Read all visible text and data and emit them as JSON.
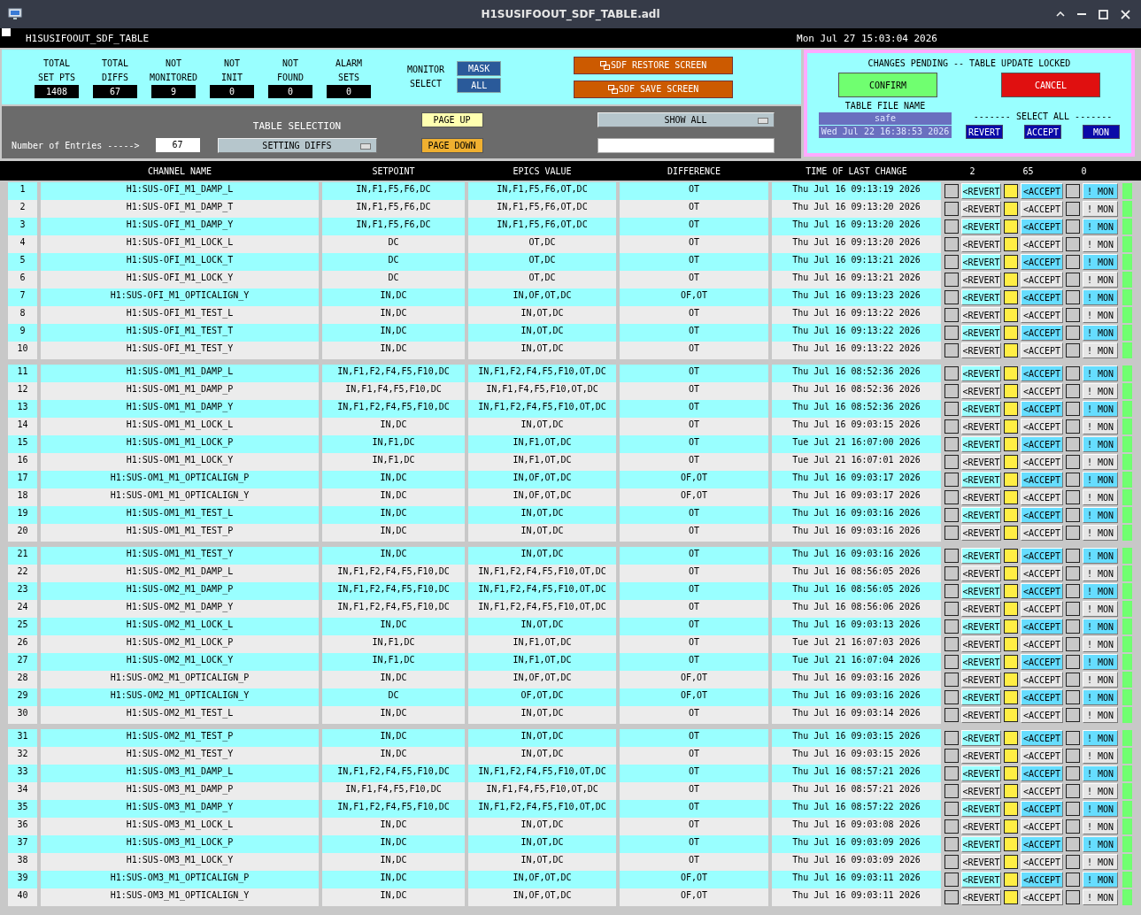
{
  "window": {
    "title": "H1SUSIFOOUT_SDF_TABLE.adl"
  },
  "header": {
    "screen_name": "H1SUSIFOOUT_SDF_TABLE",
    "datetime": "Mon Jul 27 15:03:04 2026"
  },
  "stats": [
    {
      "label": [
        "TOTAL",
        "SET PTS"
      ],
      "value": "1408"
    },
    {
      "label": [
        "TOTAL",
        "DIFFS"
      ],
      "value": "67"
    },
    {
      "label": [
        "NOT",
        "MONITORED"
      ],
      "value": "9"
    },
    {
      "label": [
        "NOT",
        "INIT"
      ],
      "value": "0"
    },
    {
      "label": [
        "NOT",
        "FOUND"
      ],
      "value": "0"
    },
    {
      "label": [
        "ALARM",
        "SETS"
      ],
      "value": "0"
    }
  ],
  "monitor_select": {
    "label": [
      "MONITOR",
      "SELECT"
    ],
    "buttons": [
      "MASK",
      "ALL"
    ]
  },
  "screen_buttons": [
    "SDF RESTORE SCREEN",
    "SDF SAVE SCREEN"
  ],
  "pending": {
    "message": "CHANGES PENDING -- TABLE UPDATE LOCKED",
    "confirm": "CONFIRM",
    "cancel": "CANCEL",
    "file_label": "TABLE FILE NAME",
    "file_name": "safe",
    "file_time": "Wed Jul 22 16:38:53 2026",
    "select_all_label": "------- SELECT ALL -------",
    "select_all_buttons": [
      "REVERT",
      "ACCEPT",
      "MON"
    ]
  },
  "table_selection": {
    "label": "TABLE SELECTION",
    "entries_label": "Number of Entries ----->",
    "entries": "67",
    "selection": "SETTING DIFFS",
    "page_buttons": [
      "PAGE UP",
      "PAGE DOWN"
    ],
    "filter": "SHOW ALL"
  },
  "table": {
    "columns": [
      "CHANNEL NAME",
      "SETPOINT",
      "EPICS VALUE",
      "DIFFERENCE",
      "TIME OF LAST CHANGE",
      "2",
      "65",
      "0"
    ],
    "rows": [
      {
        "index": "1",
        "channel": "H1:SUS-OFI_M1_DAMP_L",
        "setpoint": "IN,F1,F5,F6,DC",
        "epics_value": "IN,F1,F5,F6,OT,DC",
        "difference": "OT",
        "time": "Thu Jul 16 09:13:19 2026",
        "revert_checked": false,
        "revert": "<REVERT",
        "accept_checked": true,
        "accept": "<ACCEPT",
        "mon_checked": false,
        "mon": "! MON"
      },
      {
        "index": "2",
        "channel": "H1:SUS-OFI_M1_DAMP_T",
        "setpoint": "IN,F1,F5,F6,DC",
        "epics_value": "IN,F1,F5,F6,OT,DC",
        "difference": "OT",
        "time": "Thu Jul 16 09:13:20 2026",
        "revert_checked": false,
        "revert": "<REVERT",
        "accept_checked": true,
        "accept": "<ACCEPT",
        "mon_checked": false,
        "mon": "! MON"
      },
      {
        "index": "3",
        "channel": "H1:SUS-OFI_M1_DAMP_Y",
        "setpoint": "IN,F1,F5,F6,DC",
        "epics_value": "IN,F1,F5,F6,OT,DC",
        "difference": "OT",
        "time": "Thu Jul 16 09:13:20 2026",
        "revert_checked": false,
        "revert": "<REVERT",
        "accept_checked": true,
        "accept": "<ACCEPT",
        "mon_checked": false,
        "mon": "! MON"
      },
      {
        "index": "4",
        "channel": "H1:SUS-OFI_M1_LOCK_L",
        "setpoint": "DC",
        "epics_value": "OT,DC",
        "difference": "OT",
        "time": "Thu Jul 16 09:13:20 2026",
        "revert_checked": false,
        "revert": "<REVERT",
        "accept_checked": true,
        "accept": "<ACCEPT",
        "mon_checked": false,
        "mon": "! MON"
      },
      {
        "index": "5",
        "channel": "H1:SUS-OFI_M1_LOCK_T",
        "setpoint": "DC",
        "epics_value": "OT,DC",
        "difference": "OT",
        "time": "Thu Jul 16 09:13:21 2026",
        "revert_checked": false,
        "revert": "<REVERT",
        "accept_checked": true,
        "accept": "<ACCEPT",
        "mon_checked": false,
        "mon": "! MON"
      },
      {
        "index": "6",
        "channel": "H1:SUS-OFI_M1_LOCK_Y",
        "setpoint": "DC",
        "epics_value": "OT,DC",
        "difference": "OT",
        "time": "Thu Jul 16 09:13:21 2026",
        "revert_checked": false,
        "revert": "<REVERT",
        "accept_checked": true,
        "accept": "<ACCEPT",
        "mon_checked": false,
        "mon": "! MON"
      },
      {
        "index": "7",
        "channel": "H1:SUS-OFI_M1_OPTICALIGN_Y",
        "setpoint": "IN,DC",
        "epics_value": "IN,OF,OT,DC",
        "difference": "OF,OT",
        "time": "Thu Jul 16 09:13:23 2026",
        "revert_checked": false,
        "revert": "<REVERT",
        "accept_checked": true,
        "accept": "<ACCEPT",
        "mon_checked": false,
        "mon": "! MON"
      },
      {
        "index": "8",
        "channel": "H1:SUS-OFI_M1_TEST_L",
        "setpoint": "IN,DC",
        "epics_value": "IN,OT,DC",
        "difference": "OT",
        "time": "Thu Jul 16 09:13:22 2026",
        "revert_checked": false,
        "revert": "<REVERT",
        "accept_checked": true,
        "accept": "<ACCEPT",
        "mon_checked": false,
        "mon": "! MON"
      },
      {
        "index": "9",
        "channel": "H1:SUS-OFI_M1_TEST_T",
        "setpoint": "IN,DC",
        "epics_value": "IN,OT,DC",
        "difference": "OT",
        "time": "Thu Jul 16 09:13:22 2026",
        "revert_checked": false,
        "revert": "<REVERT",
        "accept_checked": true,
        "accept": "<ACCEPT",
        "mon_checked": false,
        "mon": "! MON"
      },
      {
        "index": "10",
        "channel": "H1:SUS-OFI_M1_TEST_Y",
        "setpoint": "IN,DC",
        "epics_value": "IN,OT,DC",
        "difference": "OT",
        "time": "Thu Jul 16 09:13:22 2026",
        "revert_checked": false,
        "revert": "<REVERT",
        "accept_checked": true,
        "accept": "<ACCEPT",
        "mon_checked": false,
        "mon": "! MON"
      },
      {
        "index": "11",
        "channel": "H1:SUS-OM1_M1_DAMP_L",
        "setpoint": "IN,F1,F2,F4,F5,F10,DC",
        "epics_value": "IN,F1,F2,F4,F5,F10,OT,DC",
        "difference": "OT",
        "time": "Thu Jul 16 08:52:36 2026",
        "revert_checked": false,
        "revert": "<REVERT",
        "accept_checked": true,
        "accept": "<ACCEPT",
        "mon_checked": false,
        "mon": "! MON"
      },
      {
        "index": "12",
        "channel": "H1:SUS-OM1_M1_DAMP_P",
        "setpoint": "IN,F1,F4,F5,F10,DC",
        "epics_value": "IN,F1,F4,F5,F10,OT,DC",
        "difference": "OT",
        "time": "Thu Jul 16 08:52:36 2026",
        "revert_checked": false,
        "revert": "<REVERT",
        "accept_checked": true,
        "accept": "<ACCEPT",
        "mon_checked": false,
        "mon": "! MON"
      },
      {
        "index": "13",
        "channel": "H1:SUS-OM1_M1_DAMP_Y",
        "setpoint": "IN,F1,F2,F4,F5,F10,DC",
        "epics_value": "IN,F1,F2,F4,F5,F10,OT,DC",
        "difference": "OT",
        "time": "Thu Jul 16 08:52:36 2026",
        "revert_checked": false,
        "revert": "<REVERT",
        "accept_checked": true,
        "accept": "<ACCEPT",
        "mon_checked": false,
        "mon": "! MON"
      },
      {
        "index": "14",
        "channel": "H1:SUS-OM1_M1_LOCK_L",
        "setpoint": "IN,DC",
        "epics_value": "IN,OT,DC",
        "difference": "OT",
        "time": "Thu Jul 16 09:03:15 2026",
        "revert_checked": false,
        "revert": "<REVERT",
        "accept_checked": true,
        "accept": "<ACCEPT",
        "mon_checked": false,
        "mon": "! MON"
      },
      {
        "index": "15",
        "channel": "H1:SUS-OM1_M1_LOCK_P",
        "setpoint": "IN,F1,DC",
        "epics_value": "IN,F1,OT,DC",
        "difference": "OT",
        "time": "Tue Jul 21 16:07:00 2026",
        "revert_checked": false,
        "revert": "<REVERT",
        "accept_checked": true,
        "accept": "<ACCEPT",
        "mon_checked": false,
        "mon": "! MON"
      },
      {
        "index": "16",
        "channel": "H1:SUS-OM1_M1_LOCK_Y",
        "setpoint": "IN,F1,DC",
        "epics_value": "IN,F1,OT,DC",
        "difference": "OT",
        "time": "Tue Jul 21 16:07:01 2026",
        "revert_checked": false,
        "revert": "<REVERT",
        "accept_checked": true,
        "accept": "<ACCEPT",
        "mon_checked": false,
        "mon": "! MON"
      },
      {
        "index": "17",
        "channel": "H1:SUS-OM1_M1_OPTICALIGN_P",
        "setpoint": "IN,DC",
        "epics_value": "IN,OF,OT,DC",
        "difference": "OF,OT",
        "time": "Thu Jul 16 09:03:17 2026",
        "revert_checked": false,
        "revert": "<REVERT",
        "accept_checked": true,
        "accept": "<ACCEPT",
        "mon_checked": false,
        "mon": "! MON"
      },
      {
        "index": "18",
        "channel": "H1:SUS-OM1_M1_OPTICALIGN_Y",
        "setpoint": "IN,DC",
        "epics_value": "IN,OF,OT,DC",
        "difference": "OF,OT",
        "time": "Thu Jul 16 09:03:17 2026",
        "revert_checked": false,
        "revert": "<REVERT",
        "accept_checked": true,
        "accept": "<ACCEPT",
        "mon_checked": false,
        "mon": "! MON"
      },
      {
        "index": "19",
        "channel": "H1:SUS-OM1_M1_TEST_L",
        "setpoint": "IN,DC",
        "epics_value": "IN,OT,DC",
        "difference": "OT",
        "time": "Thu Jul 16 09:03:16 2026",
        "revert_checked": false,
        "revert": "<REVERT",
        "accept_checked": true,
        "accept": "<ACCEPT",
        "mon_checked": false,
        "mon": "! MON"
      },
      {
        "index": "20",
        "channel": "H1:SUS-OM1_M1_TEST_P",
        "setpoint": "IN,DC",
        "epics_value": "IN,OT,DC",
        "difference": "OT",
        "time": "Thu Jul 16 09:03:16 2026",
        "revert_checked": false,
        "revert": "<REVERT",
        "accept_checked": true,
        "accept": "<ACCEPT",
        "mon_checked": false,
        "mon": "! MON"
      },
      {
        "index": "21",
        "channel": "H1:SUS-OM1_M1_TEST_Y",
        "setpoint": "IN,DC",
        "epics_value": "IN,OT,DC",
        "difference": "OT",
        "time": "Thu Jul 16 09:03:16 2026",
        "revert_checked": false,
        "revert": "<REVERT",
        "accept_checked": true,
        "accept": "<ACCEPT",
        "mon_checked": false,
        "mon": "! MON"
      },
      {
        "index": "22",
        "channel": "H1:SUS-OM2_M1_DAMP_L",
        "setpoint": "IN,F1,F2,F4,F5,F10,DC",
        "epics_value": "IN,F1,F2,F4,F5,F10,OT,DC",
        "difference": "OT",
        "time": "Thu Jul 16 08:56:05 2026",
        "revert_checked": false,
        "revert": "<REVERT",
        "accept_checked": true,
        "accept": "<ACCEPT",
        "mon_checked": false,
        "mon": "! MON"
      },
      {
        "index": "23",
        "channel": "H1:SUS-OM2_M1_DAMP_P",
        "setpoint": "IN,F1,F2,F4,F5,F10,DC",
        "epics_value": "IN,F1,F2,F4,F5,F10,OT,DC",
        "difference": "OT",
        "time": "Thu Jul 16 08:56:05 2026",
        "revert_checked": false,
        "revert": "<REVERT",
        "accept_checked": true,
        "accept": "<ACCEPT",
        "mon_checked": false,
        "mon": "! MON"
      },
      {
        "index": "24",
        "channel": "H1:SUS-OM2_M1_DAMP_Y",
        "setpoint": "IN,F1,F2,F4,F5,F10,DC",
        "epics_value": "IN,F1,F2,F4,F5,F10,OT,DC",
        "difference": "OT",
        "time": "Thu Jul 16 08:56:06 2026",
        "revert_checked": false,
        "revert": "<REVERT",
        "accept_checked": true,
        "accept": "<ACCEPT",
        "mon_checked": false,
        "mon": "! MON"
      },
      {
        "index": "25",
        "channel": "H1:SUS-OM2_M1_LOCK_L",
        "setpoint": "IN,DC",
        "epics_value": "IN,OT,DC",
        "difference": "OT",
        "time": "Thu Jul 16 09:03:13 2026",
        "revert_checked": false,
        "revert": "<REVERT",
        "accept_checked": true,
        "accept": "<ACCEPT",
        "mon_checked": false,
        "mon": "! MON"
      },
      {
        "index": "26",
        "channel": "H1:SUS-OM2_M1_LOCK_P",
        "setpoint": "IN,F1,DC",
        "epics_value": "IN,F1,OT,DC",
        "difference": "OT",
        "time": "Tue Jul 21 16:07:03 2026",
        "revert_checked": false,
        "revert": "<REVERT",
        "accept_checked": true,
        "accept": "<ACCEPT",
        "mon_checked": false,
        "mon": "! MON"
      },
      {
        "index": "27",
        "channel": "H1:SUS-OM2_M1_LOCK_Y",
        "setpoint": "IN,F1,DC",
        "epics_value": "IN,F1,OT,DC",
        "difference": "OT",
        "time": "Tue Jul 21 16:07:04 2026",
        "revert_checked": false,
        "revert": "<REVERT",
        "accept_checked": true,
        "accept": "<ACCEPT",
        "mon_checked": false,
        "mon": "! MON"
      },
      {
        "index": "28",
        "channel": "H1:SUS-OM2_M1_OPTICALIGN_P",
        "setpoint": "IN,DC",
        "epics_value": "IN,OF,OT,DC",
        "difference": "OF,OT",
        "time": "Thu Jul 16 09:03:16 2026",
        "revert_checked": false,
        "revert": "<REVERT",
        "accept_checked": true,
        "accept": "<ACCEPT",
        "mon_checked": false,
        "mon": "! MON"
      },
      {
        "index": "29",
        "channel": "H1:SUS-OM2_M1_OPTICALIGN_Y",
        "setpoint": "DC",
        "epics_value": "OF,OT,DC",
        "difference": "OF,OT",
        "time": "Thu Jul 16 09:03:16 2026",
        "revert_checked": false,
        "revert": "<REVERT",
        "accept_checked": true,
        "accept": "<ACCEPT",
        "mon_checked": false,
        "mon": "! MON"
      },
      {
        "index": "30",
        "channel": "H1:SUS-OM2_M1_TEST_L",
        "setpoint": "IN,DC",
        "epics_value": "IN,OT,DC",
        "difference": "OT",
        "time": "Thu Jul 16 09:03:14 2026",
        "revert_checked": false,
        "revert": "<REVERT",
        "accept_checked": true,
        "accept": "<ACCEPT",
        "mon_checked": false,
        "mon": "! MON"
      },
      {
        "index": "31",
        "channel": "H1:SUS-OM2_M1_TEST_P",
        "setpoint": "IN,DC",
        "epics_value": "IN,OT,DC",
        "difference": "OT",
        "time": "Thu Jul 16 09:03:15 2026",
        "revert_checked": false,
        "revert": "<REVERT",
        "accept_checked": true,
        "accept": "<ACCEPT",
        "mon_checked": false,
        "mon": "! MON"
      },
      {
        "index": "32",
        "channel": "H1:SUS-OM2_M1_TEST_Y",
        "setpoint": "IN,DC",
        "epics_value": "IN,OT,DC",
        "difference": "OT",
        "time": "Thu Jul 16 09:03:15 2026",
        "revert_checked": false,
        "revert": "<REVERT",
        "accept_checked": true,
        "accept": "<ACCEPT",
        "mon_checked": false,
        "mon": "! MON"
      },
      {
        "index": "33",
        "channel": "H1:SUS-OM3_M1_DAMP_L",
        "setpoint": "IN,F1,F2,F4,F5,F10,DC",
        "epics_value": "IN,F1,F2,F4,F5,F10,OT,DC",
        "difference": "OT",
        "time": "Thu Jul 16 08:57:21 2026",
        "revert_checked": false,
        "revert": "<REVERT",
        "accept_checked": true,
        "accept": "<ACCEPT",
        "mon_checked": false,
        "mon": "! MON"
      },
      {
        "index": "34",
        "channel": "H1:SUS-OM3_M1_DAMP_P",
        "setpoint": "IN,F1,F4,F5,F10,DC",
        "epics_value": "IN,F1,F4,F5,F10,OT,DC",
        "difference": "OT",
        "time": "Thu Jul 16 08:57:21 2026",
        "revert_checked": false,
        "revert": "<REVERT",
        "accept_checked": true,
        "accept": "<ACCEPT",
        "mon_checked": false,
        "mon": "! MON"
      },
      {
        "index": "35",
        "channel": "H1:SUS-OM3_M1_DAMP_Y",
        "setpoint": "IN,F1,F2,F4,F5,F10,DC",
        "epics_value": "IN,F1,F2,F4,F5,F10,OT,DC",
        "difference": "OT",
        "time": "Thu Jul 16 08:57:22 2026",
        "revert_checked": false,
        "revert": "<REVERT",
        "accept_checked": true,
        "accept": "<ACCEPT",
        "mon_checked": false,
        "mon": "! MON"
      },
      {
        "index": "36",
        "channel": "H1:SUS-OM3_M1_LOCK_L",
        "setpoint": "IN,DC",
        "epics_value": "IN,OT,DC",
        "difference": "OT",
        "time": "Thu Jul 16 09:03:08 2026",
        "revert_checked": false,
        "revert": "<REVERT",
        "accept_checked": true,
        "accept": "<ACCEPT",
        "mon_checked": false,
        "mon": "! MON"
      },
      {
        "index": "37",
        "channel": "H1:SUS-OM3_M1_LOCK_P",
        "setpoint": "IN,DC",
        "epics_value": "IN,OT,DC",
        "difference": "OT",
        "time": "Thu Jul 16 09:03:09 2026",
        "revert_checked": false,
        "revert": "<REVERT",
        "accept_checked": true,
        "accept": "<ACCEPT",
        "mon_checked": false,
        "mon": "! MON"
      },
      {
        "index": "38",
        "channel": "H1:SUS-OM3_M1_LOCK_Y",
        "setpoint": "IN,DC",
        "epics_value": "IN,OT,DC",
        "difference": "OT",
        "time": "Thu Jul 16 09:03:09 2026",
        "revert_checked": false,
        "revert": "<REVERT",
        "accept_checked": true,
        "accept": "<ACCEPT",
        "mon_checked": false,
        "mon": "! MON"
      },
      {
        "index": "39",
        "channel": "H1:SUS-OM3_M1_OPTICALIGN_P",
        "setpoint": "IN,DC",
        "epics_value": "IN,OF,OT,DC",
        "difference": "OF,OT",
        "time": "Thu Jul 16 09:03:11 2026",
        "revert_checked": false,
        "revert": "<REVERT",
        "accept_checked": true,
        "accept": "<ACCEPT",
        "mon_checked": false,
        "mon": "! MON"
      },
      {
        "index": "40",
        "channel": "H1:SUS-OM3_M1_OPTICALIGN_Y",
        "setpoint": "IN,DC",
        "epics_value": "IN,OF,OT,DC",
        "difference": "OF,OT",
        "time": "Thu Jul 16 09:03:11 2026",
        "revert_checked": false,
        "revert": "<REVERT",
        "accept_checked": true,
        "accept": "<ACCEPT",
        "mon_checked": false,
        "mon": "! MON"
      }
    ]
  }
}
